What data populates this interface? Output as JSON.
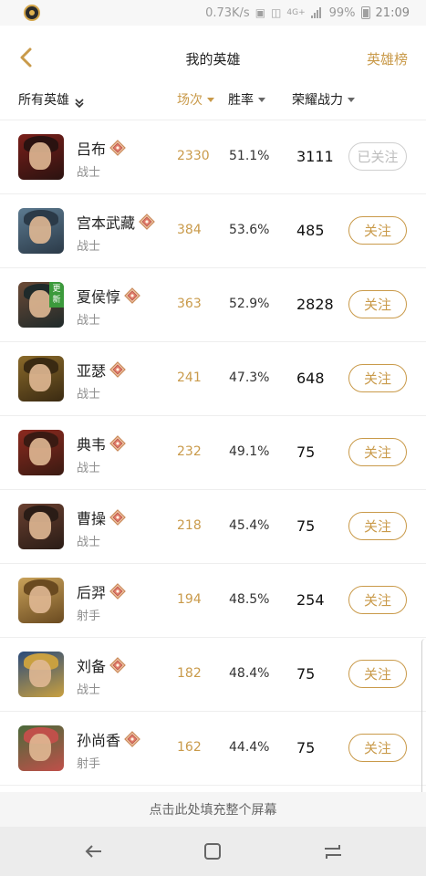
{
  "status_bar": {
    "speed": "0.73K/s",
    "network": "4G+",
    "battery": "99%",
    "time": "21:09"
  },
  "header": {
    "title": "我的英雄",
    "right_link": "英雄榜"
  },
  "sort_header": {
    "filter_label": "所有英雄",
    "col_games": "场次",
    "col_winrate": "胜率",
    "col_power": "荣耀战力"
  },
  "heroes": [
    {
      "name": "吕布",
      "role": "战士",
      "games": "2330",
      "winrate": "51.1%",
      "power": "3111",
      "follow": "已关注",
      "followed": true,
      "colors": [
        "#7a1f1a",
        "#2a1210"
      ]
    },
    {
      "name": "宫本武藏",
      "role": "战士",
      "games": "384",
      "winrate": "53.6%",
      "power": "485",
      "follow": "关注",
      "followed": false,
      "colors": [
        "#5c7a90",
        "#2b3a48"
      ]
    },
    {
      "name": "夏侯惇",
      "role": "战士",
      "games": "363",
      "winrate": "52.9%",
      "power": "2828",
      "follow": "关注",
      "followed": false,
      "colors": [
        "#6b4a36",
        "#1f2a2a"
      ],
      "badge": "更新"
    },
    {
      "name": "亚瑟",
      "role": "战士",
      "games": "241",
      "winrate": "47.3%",
      "power": "648",
      "follow": "关注",
      "followed": false,
      "colors": [
        "#8a6a2a",
        "#3a2a12"
      ]
    },
    {
      "name": "典韦",
      "role": "战士",
      "games": "232",
      "winrate": "49.1%",
      "power": "75",
      "follow": "关注",
      "followed": false,
      "colors": [
        "#8c2a1f",
        "#3a1a12"
      ]
    },
    {
      "name": "曹操",
      "role": "战士",
      "games": "218",
      "winrate": "45.4%",
      "power": "75",
      "follow": "关注",
      "followed": false,
      "colors": [
        "#6a4030",
        "#2a1c16"
      ]
    },
    {
      "name": "后羿",
      "role": "射手",
      "games": "194",
      "winrate": "48.5%",
      "power": "254",
      "follow": "关注",
      "followed": false,
      "colors": [
        "#c9a25a",
        "#6a4a20"
      ]
    },
    {
      "name": "刘备",
      "role": "战士",
      "games": "182",
      "winrate": "48.4%",
      "power": "75",
      "follow": "关注",
      "followed": false,
      "colors": [
        "#2a4a7a",
        "#c9a040"
      ]
    },
    {
      "name": "孙尚香",
      "role": "射手",
      "games": "162",
      "winrate": "44.4%",
      "power": "75",
      "follow": "关注",
      "followed": false,
      "colors": [
        "#4a6a3a",
        "#c0504a"
      ]
    }
  ],
  "fill_hint": "点击此处填充整个屏幕",
  "colors": {
    "accent": "#c99a4a"
  }
}
